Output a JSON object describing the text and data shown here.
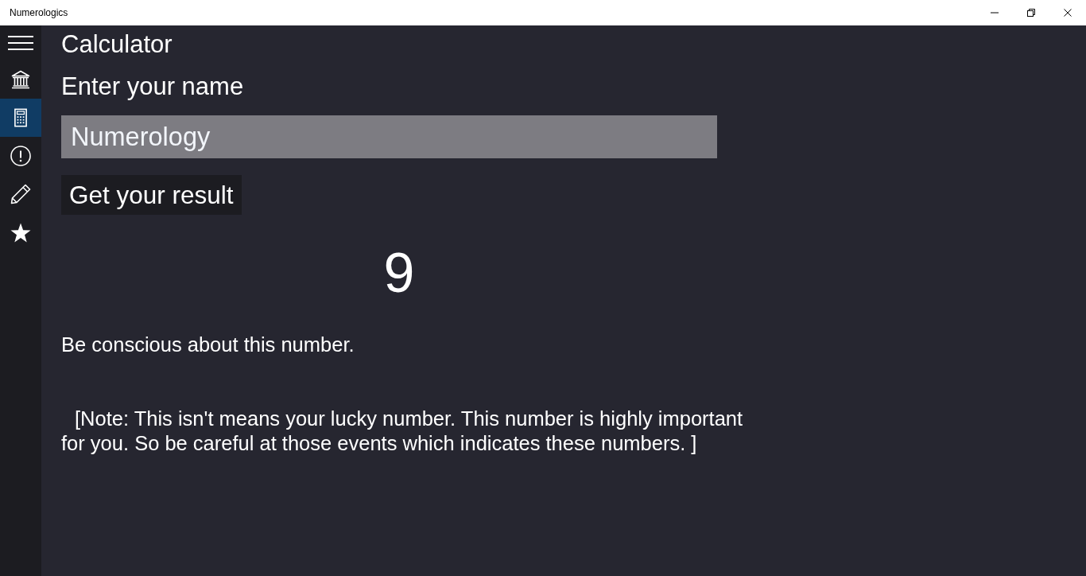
{
  "window": {
    "title": "Numerologics"
  },
  "sidebar": {
    "items": [
      {
        "kind": "bank",
        "selected": false
      },
      {
        "kind": "calculator",
        "selected": true
      },
      {
        "kind": "info",
        "selected": false
      },
      {
        "kind": "pencil",
        "selected": false
      },
      {
        "kind": "star",
        "selected": false
      }
    ]
  },
  "page": {
    "title": "Calculator",
    "name_label": "Enter your name",
    "name_field": {
      "value": "Numerology"
    },
    "submit_button": "Get your result",
    "result": "9",
    "message": "Be conscious about this number.",
    "note": "[Note: This isn't means your lucky number. This number is highly important for you. So be careful at those events which indicates these numbers. ]"
  }
}
